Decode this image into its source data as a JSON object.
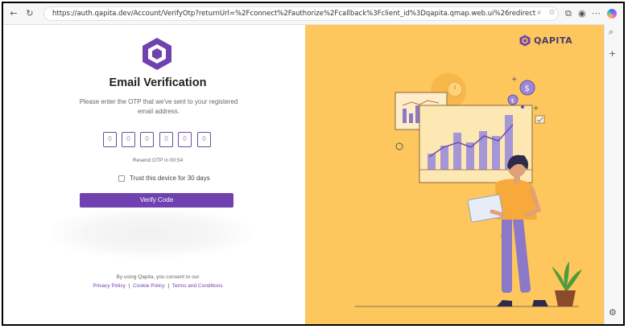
{
  "browser": {
    "url": "https://auth.qapita.dev/Account/VerifyOtp?returnUrl=%2Fconnect%2Fauthorize%2Fcallback%3Fclient_id%3Dqapita.qmap.web.ui%26redirect_uri%3Dhttps%253A%252F%252Fqmapfit.qapita.dev%252Faut..."
  },
  "login": {
    "title": "Email Verification",
    "subtitle": "Please enter the OTP that we've sent to your registered email address.",
    "otp_digits": [
      "0",
      "0",
      "0",
      "0",
      "0",
      "0"
    ],
    "resend_text": "Resend OTP in 00:54",
    "trust_label": "Trust this device for 30 days",
    "trust_checked": false,
    "verify_button": "Verify Code",
    "consent_text": "By using Qapita, you consent to our",
    "links": {
      "privacy": "Privacy Policy",
      "cookie": "Cookie Policy",
      "terms": "Terms and Conditions",
      "separator": "|"
    }
  },
  "brand": {
    "name": "QAPITA",
    "logo_color": "#6f42b0",
    "text_color": "#4a3a6e"
  },
  "colors": {
    "accent": "#6f42b0",
    "illustration_bg": "#fdc75d",
    "otp_border": "#6a4ea3"
  },
  "icons": {
    "back": "arrow-left-icon",
    "refresh": "refresh-icon",
    "site_info": "site-info-icon",
    "zoom": "zoom-icon",
    "favorite": "star-icon",
    "profile": "profile-icon",
    "more": "more-icon",
    "copilot": "copilot-icon",
    "side_search": "search-icon",
    "side_add": "plus-icon",
    "side_settings": "gear-icon"
  }
}
